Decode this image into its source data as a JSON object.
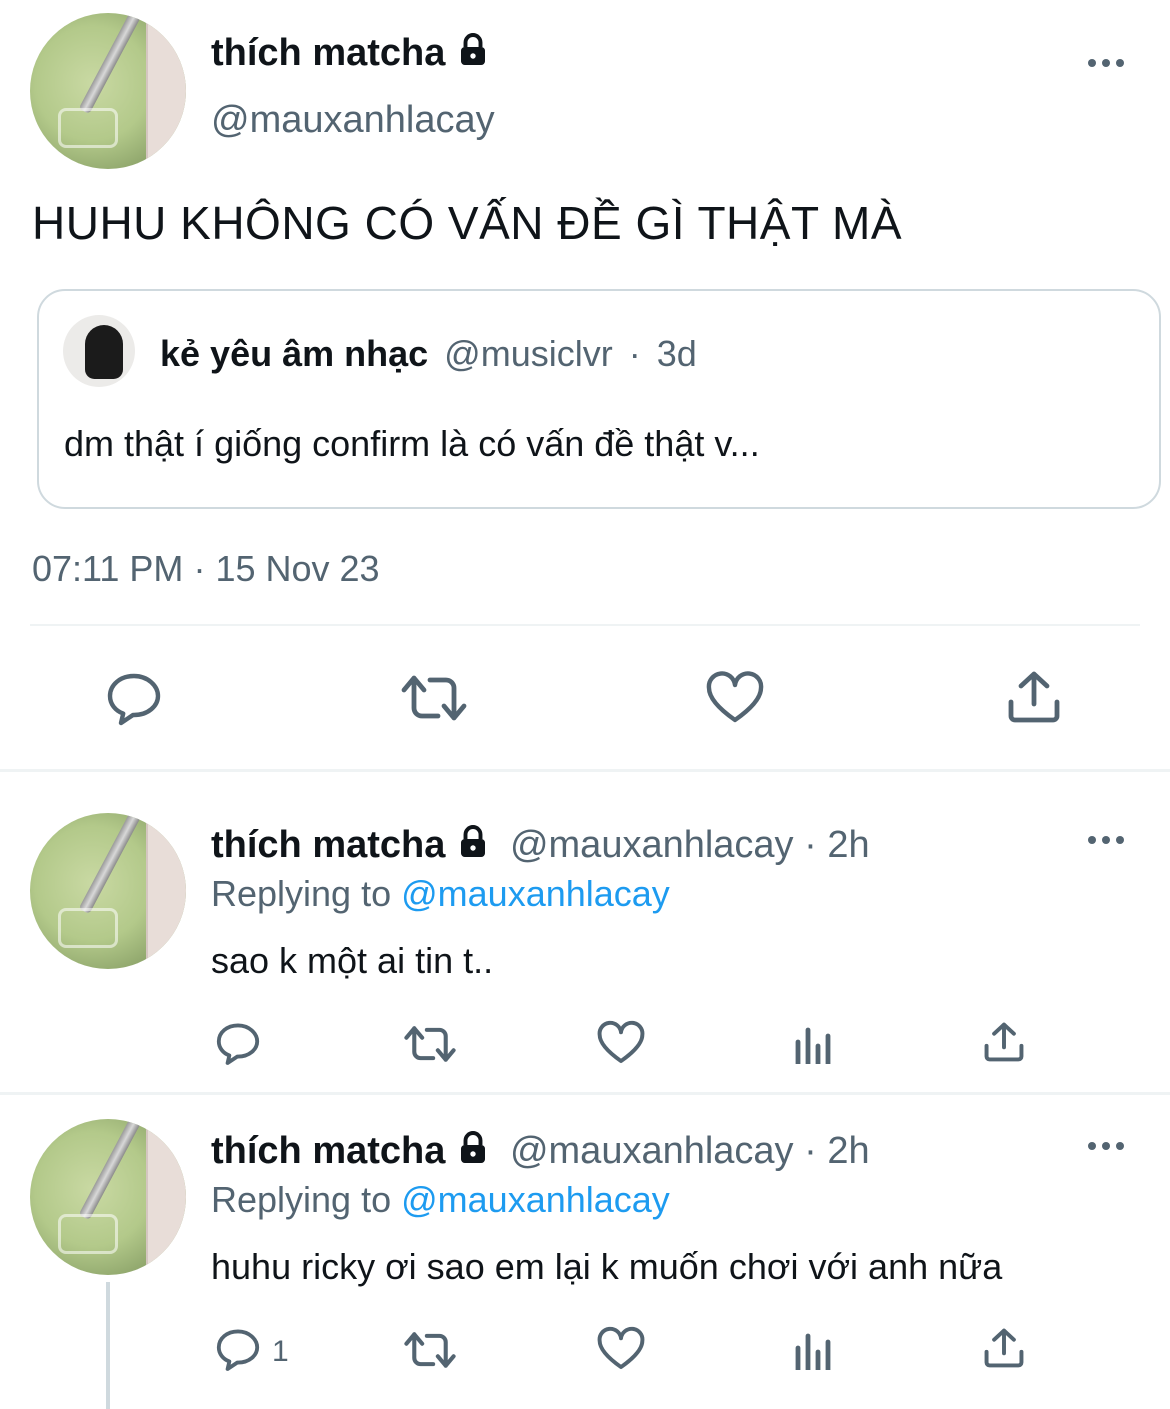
{
  "main_tweet": {
    "name": "thích matcha",
    "handle": "@mauxanhlacay",
    "text": "HUHU KHÔNG CÓ VẤN ĐỀ GÌ THẬT MÀ",
    "quoted": {
      "name": "kẻ yêu âm nhạc",
      "handle": "@musiclvr",
      "separator": "·",
      "time": "3d",
      "text": "dm thật í giống confirm là có vấn đề thật v..."
    },
    "time": "07:11 PM",
    "separator": "·",
    "date": "15 Nov 23"
  },
  "replies": [
    {
      "name": "thích matcha",
      "handle": "@mauxanhlacay",
      "separator": "·",
      "time": "2h",
      "replying_label": "Replying to",
      "replying_handle": "@mauxanhlacay",
      "text": "sao k một ai tin t..",
      "reply_count": ""
    },
    {
      "name": "thích matcha",
      "handle": "@mauxanhlacay",
      "separator": "·",
      "time": "2h",
      "replying_label": "Replying to",
      "replying_handle": "@mauxanhlacay",
      "text": "huhu ricky ơi sao em lại k muốn chơi với anh nữa",
      "reply_count": "1"
    }
  ],
  "icons": {
    "reply": "speech-bubble-icon",
    "retweet": "retweet-icon",
    "like": "heart-icon",
    "views": "bar-chart-icon",
    "share": "share-upload-icon",
    "more": "more-dots-icon",
    "lock": "lock-icon"
  },
  "colors": {
    "text": "#0f1419",
    "muted": "#536471",
    "link": "#1d9bf0",
    "border": "#cfd9de",
    "divider": "#eff3f4"
  }
}
